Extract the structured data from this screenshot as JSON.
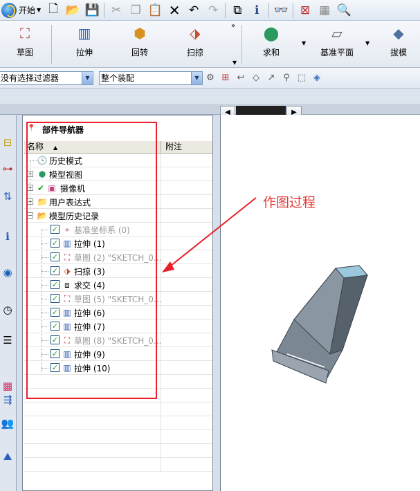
{
  "toolbar_top": {
    "start_label": "开始",
    "icons": [
      "new-file-icon",
      "open-folder-icon",
      "save-icon",
      "cut-icon",
      "copy-icon",
      "paste-icon",
      "delete-icon",
      "undo-icon",
      "redo-icon",
      "snap-view-icon",
      "information-icon",
      "binoculars-icon",
      "fit-view-icon",
      "shaded-view-icon",
      "zoom-icon"
    ]
  },
  "toolbar_main": {
    "sketch": "草图",
    "extrude": "拉伸",
    "revolve": "回转",
    "sweep": "扫掠",
    "intersect": "求和",
    "datum_plane": "基准平面",
    "draft": "拔模"
  },
  "selection_bar": {
    "filter_value": "没有选择过滤器",
    "scope_value": "整个装配"
  },
  "navigator": {
    "title": "部件导航器",
    "col_name": "名称",
    "col_note": "附注",
    "items": [
      {
        "label": "历史模式",
        "level": 0,
        "icon": "clock-icon",
        "dim": false
      },
      {
        "label": "模型视图",
        "level": 0,
        "icon": "model-view-icon",
        "dim": false
      },
      {
        "label": "摄像机",
        "level": 0,
        "icon": "camera-icon",
        "dim": false
      },
      {
        "label": "用户表达式",
        "level": 0,
        "icon": "folder-icon",
        "dim": false
      },
      {
        "label": "模型历史记录",
        "level": 0,
        "icon": "folder-open-icon",
        "dim": false
      },
      {
        "label": "基准坐标系 (0)",
        "level": 1,
        "icon": "datum-csys-icon",
        "dim": true
      },
      {
        "label": "拉伸 (1)",
        "level": 1,
        "icon": "extrude-icon",
        "dim": false
      },
      {
        "label": "草图 (2) \"SKETCH_0...",
        "level": 1,
        "icon": "sketch-icon",
        "dim": true
      },
      {
        "label": "扫掠 (3)",
        "level": 1,
        "icon": "sweep-icon",
        "dim": false
      },
      {
        "label": "求交 (4)",
        "level": 1,
        "icon": "intersect-icon",
        "dim": false
      },
      {
        "label": "草图 (5) \"SKETCH_0...",
        "level": 1,
        "icon": "sketch-icon",
        "dim": true
      },
      {
        "label": "拉伸 (6)",
        "level": 1,
        "icon": "extrude-icon",
        "dim": false
      },
      {
        "label": "拉伸 (7)",
        "level": 1,
        "icon": "extrude-icon",
        "dim": false
      },
      {
        "label": "草图 (8) \"SKETCH_0...",
        "level": 1,
        "icon": "sketch-icon",
        "dim": true
      },
      {
        "label": "拉伸 (9)",
        "level": 1,
        "icon": "extrude-icon",
        "dim": false
      },
      {
        "label": "拉伸 (10)",
        "level": 1,
        "icon": "extrude-icon",
        "dim": false
      }
    ]
  },
  "annotation": "作图过程",
  "colors": {
    "highlight": "#e8202a",
    "model_face": "#7b8792"
  }
}
